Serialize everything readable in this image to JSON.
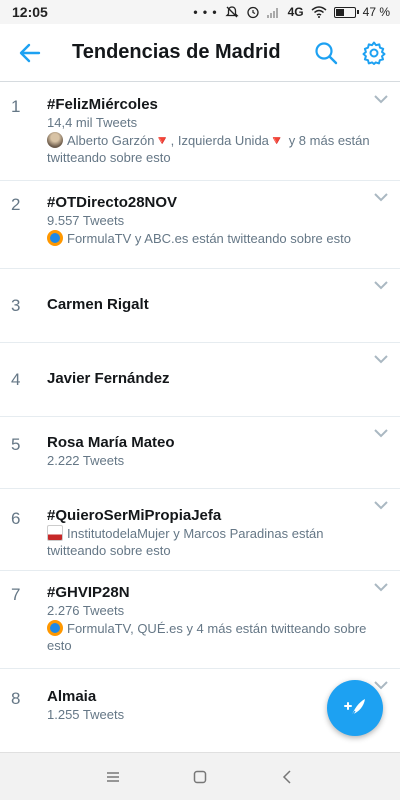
{
  "status_bar": {
    "time": "12:05",
    "dots": "• • •",
    "network": "4G",
    "battery": "47 %",
    "battery_level": 0.47
  },
  "header": {
    "title": "Tendencias de Madrid",
    "icons": [
      "back-arrow-icon",
      "search-icon",
      "gear-icon"
    ],
    "accent_color": "#1da1f2"
  },
  "trends": [
    {
      "rank": "1",
      "name": "#FelizMiércoles",
      "count": "14,4 mil Tweets",
      "context": "Alberto Garzón🔻, Izquierda Unida🔻 y 8 más están twitteando sobre esto",
      "avatar": "person-avatar"
    },
    {
      "rank": "2",
      "name": "#OTDirecto28NOV",
      "count": "9.557 Tweets",
      "context": "FormulaTV y ABC.es están twitteando sobre esto",
      "avatar": "formulatv-avatar"
    },
    {
      "rank": "3",
      "name": "Carmen Rigalt"
    },
    {
      "rank": "4",
      "name": "Javier Fernández"
    },
    {
      "rank": "5",
      "name": "Rosa María Mateo",
      "count": "2.222 Tweets"
    },
    {
      "rank": "6",
      "name": "#QuieroSerMiPropiaJefa",
      "context": "InstitutodelaMujer y Marcos Paradinas están twitteando sobre esto",
      "avatar": "instituto-avatar"
    },
    {
      "rank": "7",
      "name": "#GHVIP28N",
      "count": "2.276 Tweets",
      "context": "FormulaTV, QUÉ.es y 4 más están twitteando sobre esto",
      "avatar": "formulatv-avatar"
    },
    {
      "rank": "8",
      "name": "Almaia",
      "count": "1.255 Tweets"
    }
  ]
}
